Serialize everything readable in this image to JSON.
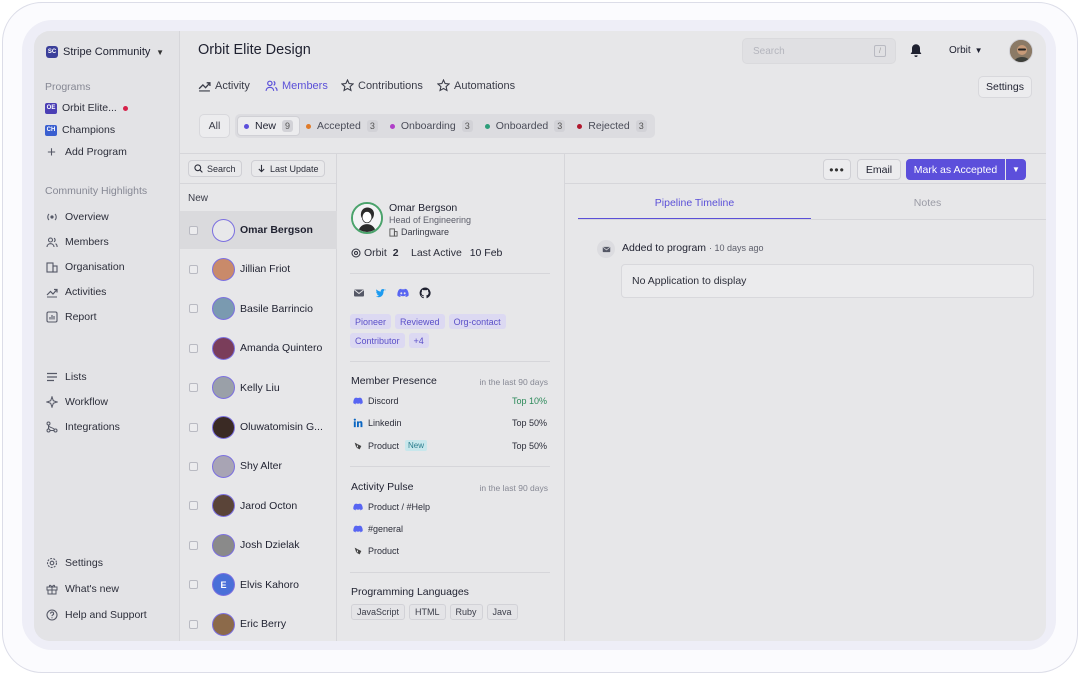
{
  "sidebar": {
    "workspace_logo": "SC",
    "workspace_name": "Stripe Community",
    "programs_title": "Programs",
    "programs": [
      {
        "badge": "OE",
        "label": "Orbit Elite...",
        "color": "#4b3fb5"
      },
      {
        "badge": "CH",
        "label": "Champions",
        "color": "#3a5fd0"
      }
    ],
    "add_program": "Add Program",
    "highlights_title": "Community Highlights",
    "highlights": [
      {
        "label": "Overview",
        "icon": "overview-icon"
      },
      {
        "label": "Members",
        "icon": "members-icon"
      },
      {
        "label": "Organisation",
        "icon": "organisation-icon"
      },
      {
        "label": "Activities",
        "icon": "activities-icon"
      },
      {
        "label": "Report",
        "icon": "report-icon"
      }
    ],
    "tools": [
      {
        "label": "Lists",
        "icon": "lists-icon"
      },
      {
        "label": "Workflow",
        "icon": "workflow-icon"
      },
      {
        "label": "Integrations",
        "icon": "integrations-icon"
      }
    ],
    "footer": [
      {
        "label": "Settings",
        "icon": "gear-icon"
      },
      {
        "label": "What's new",
        "icon": "gift-icon"
      },
      {
        "label": "Help and Support",
        "icon": "help-icon"
      }
    ]
  },
  "header": {
    "title": "Orbit Elite Design",
    "search_placeholder": "Search",
    "search_shortcut": "/",
    "user_menu": "Orbit"
  },
  "nav": {
    "tabs": [
      {
        "label": "Activity",
        "active": false
      },
      {
        "label": "Members",
        "active": true
      },
      {
        "label": "Contributions",
        "active": false
      },
      {
        "label": "Automations",
        "active": false
      }
    ],
    "settings_label": "Settings"
  },
  "filters": {
    "all_label": "All",
    "statuses": [
      {
        "label": "New",
        "count": "9",
        "color": "#5c4fdb",
        "active": true
      },
      {
        "label": "Accepted",
        "count": "3",
        "color": "#e07b2a",
        "active": false
      },
      {
        "label": "Onboarding",
        "count": "3",
        "color": "#b03fc8",
        "active": false
      },
      {
        "label": "Onboarded",
        "count": "3",
        "color": "#2e9e7a",
        "active": false
      },
      {
        "label": "Rejected",
        "count": "3",
        "color": "#b0182e",
        "active": false
      }
    ]
  },
  "list": {
    "search_label": "Search",
    "sort_label": "Last Update",
    "section_label": "New",
    "members": [
      {
        "name": "Omar Bergson",
        "selected": true,
        "bg": "#e8e8ea",
        "initial": ""
      },
      {
        "name": "Jillian Friot",
        "selected": false,
        "bg": "#c98a6a",
        "initial": ""
      },
      {
        "name": "Basile Barrincio",
        "selected": false,
        "bg": "#7a9ab0",
        "initial": ""
      },
      {
        "name": "Amanda Quintero",
        "selected": false,
        "bg": "#7a3d5a",
        "initial": ""
      },
      {
        "name": "Kelly Liu",
        "selected": false,
        "bg": "#9aa0a8",
        "initial": ""
      },
      {
        "name": "Oluwatomisin G...",
        "selected": false,
        "bg": "#3a2a24",
        "initial": ""
      },
      {
        "name": "Shy Alter",
        "selected": false,
        "bg": "#a8a4b4",
        "initial": ""
      },
      {
        "name": "Jarod Octon",
        "selected": false,
        "bg": "#5a4438",
        "initial": ""
      },
      {
        "name": "Josh Dzielak",
        "selected": false,
        "bg": "#8a8a8a",
        "initial": ""
      },
      {
        "name": "Elvis Kahoro",
        "selected": false,
        "bg": "#4a6fd8",
        "initial": "E"
      },
      {
        "name": "Eric Berry",
        "selected": false,
        "bg": "#8c6a4a",
        "initial": ""
      }
    ]
  },
  "profile": {
    "name": "Omar Bergson",
    "role": "Head of Engineering",
    "company": "Darlingware",
    "orbit_label": "Orbit",
    "orbit_level": "2",
    "last_active_label": "Last Active",
    "last_active_value": "10 Feb",
    "socials": [
      "email-icon",
      "twitter-icon",
      "discord-icon",
      "github-icon"
    ],
    "tags": [
      "Pioneer",
      "Reviewed",
      "Org-contact",
      "Contributor",
      "+4"
    ],
    "presence": {
      "title": "Member Presence",
      "subtitle": "in the last 90 days",
      "rows": [
        {
          "label": "Discord",
          "value": "Top 10%",
          "icon": "discord-icon",
          "badge": ""
        },
        {
          "label": "Linkedin",
          "value": "Top 50%",
          "icon": "linkedin-icon",
          "badge": ""
        },
        {
          "label": "Product",
          "value": "Top 50%",
          "icon": "product-icon",
          "badge": "New"
        }
      ]
    },
    "pulse": {
      "title": "Activity Pulse",
      "subtitle": "in the last 90 days",
      "rows": [
        {
          "label": "Product / #Help",
          "icon": "discord-icon"
        },
        {
          "label": "#general",
          "icon": "discord-icon"
        },
        {
          "label": "Product",
          "icon": "product-icon"
        }
      ]
    },
    "languages": {
      "title": "Programming Languages",
      "items": [
        "JavaScript",
        "HTML",
        "Ruby",
        "Java"
      ]
    }
  },
  "actions": {
    "more_label": "•••",
    "email_label": "Email",
    "accept_label": "Mark as Accepted"
  },
  "timeline": {
    "tabs": [
      {
        "label": "Pipeline Timeline",
        "active": true
      },
      {
        "label": "Notes",
        "active": false
      }
    ],
    "event": "Added to program",
    "event_time": "· 10 days ago",
    "empty": "No Application to display"
  }
}
